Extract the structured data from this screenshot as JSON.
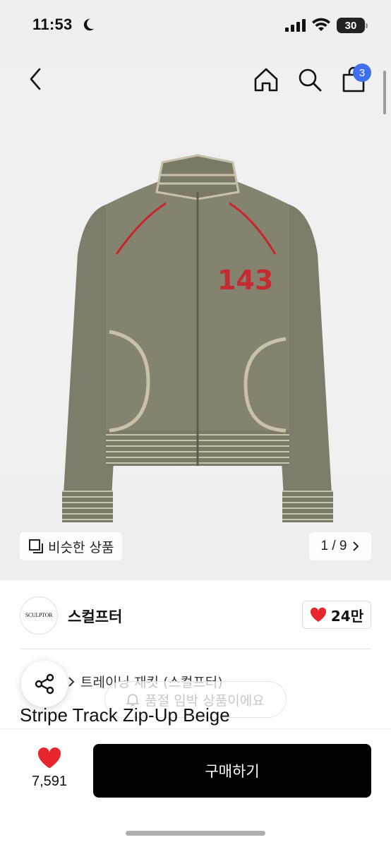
{
  "status_bar": {
    "time": "11:53",
    "battery": "30"
  },
  "nav": {
    "cart_count": "3"
  },
  "image_overlay": {
    "similar_label": "비슷한 상품",
    "pager_text": "1 / 9"
  },
  "brand": {
    "logo_text": "SCULPTOR",
    "name": "스컬프터",
    "likes": "24만"
  },
  "breadcrumb": {
    "category": "트레이닝 재킷 (스컬프터)"
  },
  "notice_pill": "품절 임박 상품이에요",
  "product": {
    "title": "Stripe Track Zip-Up Beige"
  },
  "bottom": {
    "fav_count": "7,591",
    "buy_label": "구매하기"
  },
  "colors": {
    "accent_blue": "#3e6ff0",
    "heart_red": "#e8262d",
    "buy_bg": "#000000"
  }
}
